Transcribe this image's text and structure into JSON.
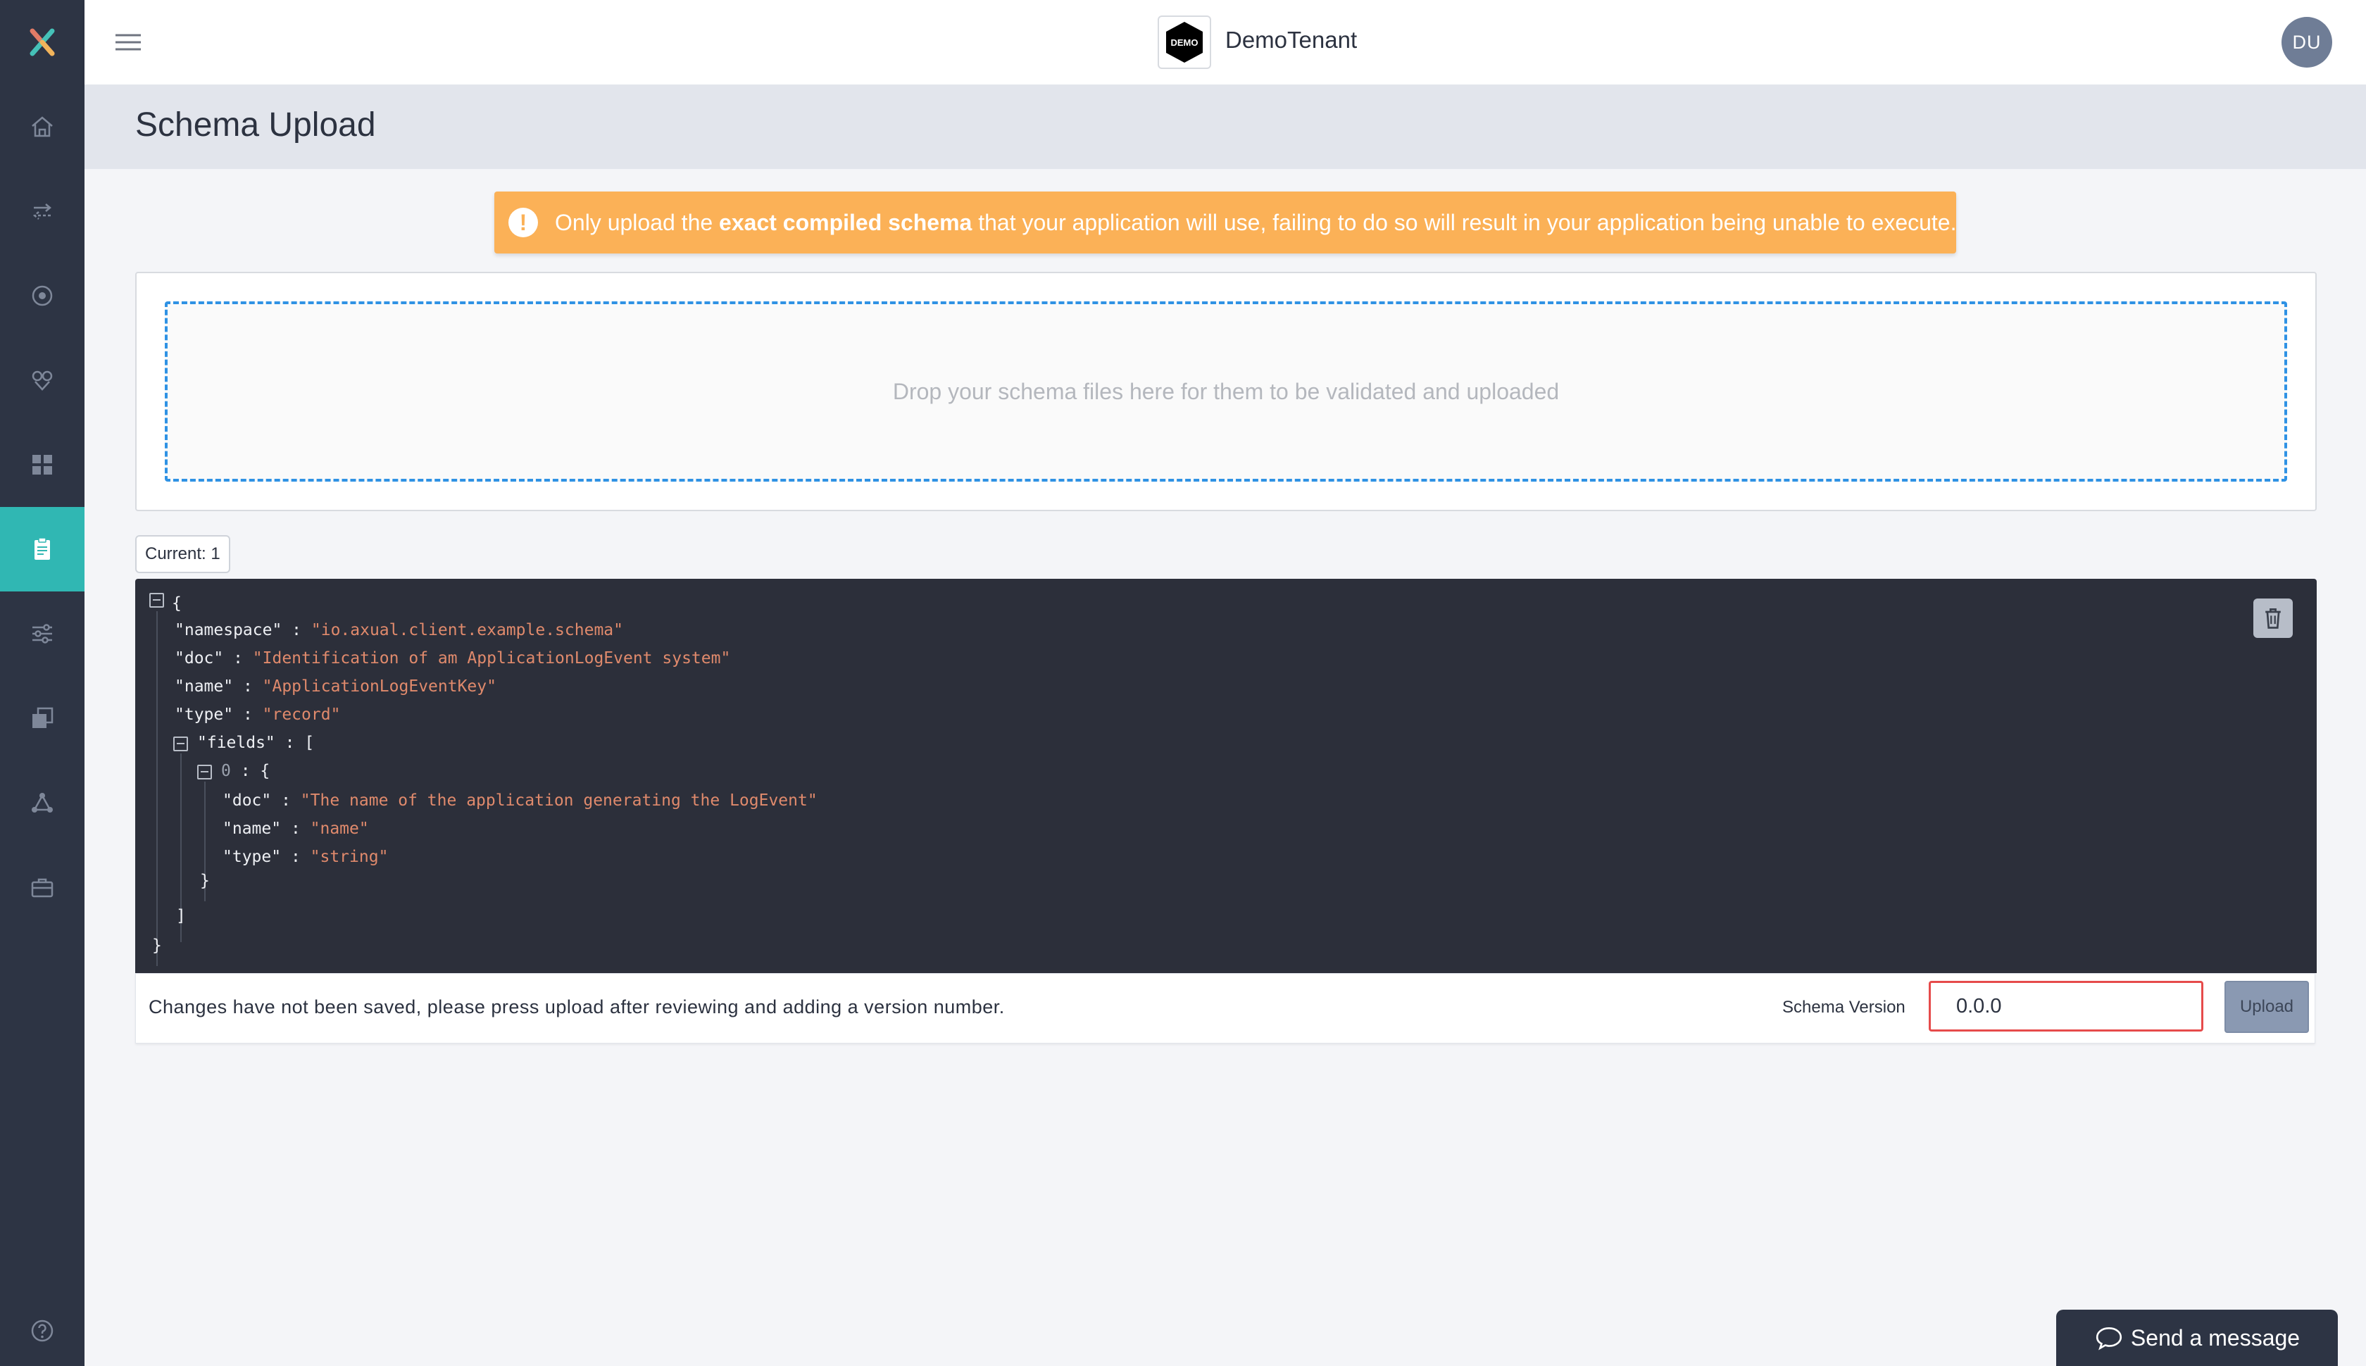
{
  "topbar": {
    "tenant_logo_text": "DEMO",
    "tenant_name": "DemoTenant",
    "avatar_initials": "DU"
  },
  "sidebar": {
    "items": [
      {
        "icon": "app-logo-icon"
      },
      {
        "icon": "home-icon"
      },
      {
        "icon": "streams-arrows-icon"
      },
      {
        "icon": "target-circle-icon"
      },
      {
        "icon": "connector-icon"
      },
      {
        "icon": "dashboard-grid-icon"
      },
      {
        "icon": "schema-clipboard-icon",
        "active": true
      },
      {
        "icon": "settings-sliders-icon"
      },
      {
        "icon": "copy-icon"
      },
      {
        "icon": "network-nodes-icon"
      },
      {
        "icon": "briefcase-icon"
      },
      {
        "icon": "help-icon"
      }
    ]
  },
  "page": {
    "title": "Schema Upload"
  },
  "alert": {
    "text_before": "Only upload the ",
    "text_bold": "exact compiled schema",
    "text_after": " that your application will use, failing to do so will result in your application being unable to execute."
  },
  "dropzone": {
    "text": "Drop your schema files here for them to be validated and uploaded"
  },
  "current_tag": "Current: 1",
  "json": {
    "open_brace": "{",
    "namespace_key": "\"namespace\"",
    "namespace_val": "\"io.axual.client.example.schema\"",
    "doc_key": "\"doc\"",
    "doc_val": "\"Identification of am ApplicationLogEvent system\"",
    "name_key": "\"name\"",
    "name_val": "\"ApplicationLogEventKey\"",
    "type_key": "\"type\"",
    "type_val": "\"record\"",
    "fields_key": "\"fields\"",
    "fields_open": "[",
    "item_index": "0",
    "item_open": "{",
    "f_doc_key": "\"doc\"",
    "f_doc_val": "\"The name of the application generating the LogEvent\"",
    "f_name_key": "\"name\"",
    "f_name_val": "\"name\"",
    "f_type_key": "\"type\"",
    "f_type_val": "\"string\"",
    "item_close": "}",
    "fields_close": "]",
    "close_brace": "}",
    "sep": " : "
  },
  "save_bar": {
    "message": "Changes have not been saved, please press upload after reviewing and adding a version number.",
    "version_label": "Schema Version",
    "version_value": "0.0.0",
    "upload_label": "Upload"
  },
  "chat": {
    "label": "Send a message"
  },
  "colors": {
    "sidebar_bg": "#2d3444",
    "active_teal": "#30b7b3",
    "alert_orange": "#fbb157",
    "dropzone_border": "#2f92e4",
    "json_bg": "#2c2f3a",
    "json_string": "#e08a6c",
    "input_error": "#e64b4b"
  }
}
